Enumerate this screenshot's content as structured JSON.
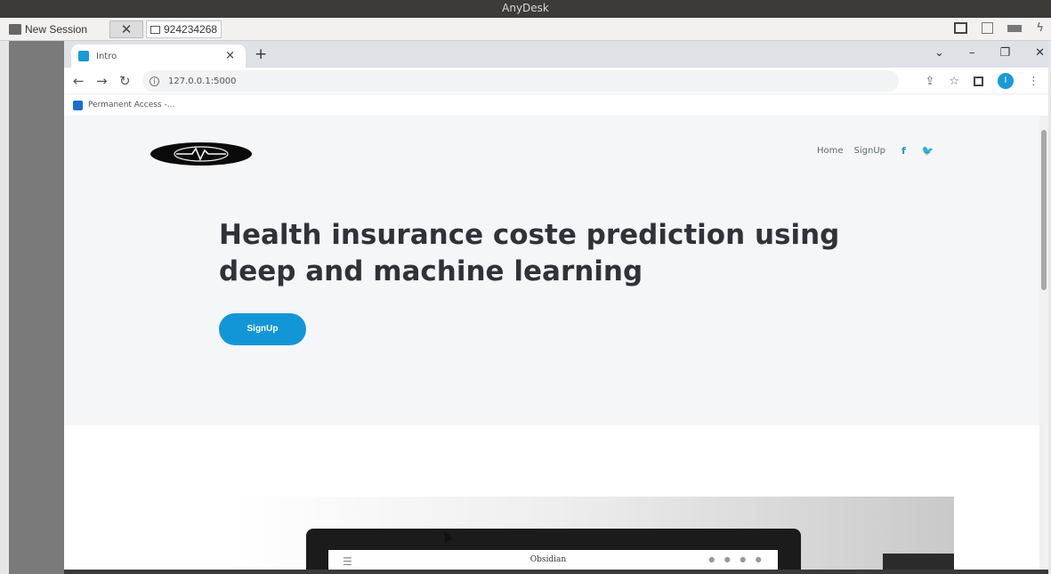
{
  "os": {
    "window_title": "AnyDesk"
  },
  "anydesk": {
    "new_session_label": "New Session",
    "close_glyph": "✕",
    "remote_id": "924234268",
    "icons": [
      "monitor-icon",
      "chat-icon",
      "keyboard-icon",
      "lightning-icon"
    ]
  },
  "browser": {
    "tab_title": "Intro",
    "tab_close": "×",
    "new_tab": "+",
    "window_controls": [
      "⌄",
      "–",
      "❐",
      "✕"
    ],
    "url": "127.0.0.1:5000",
    "bookmark": "Permanent Access -..."
  },
  "site": {
    "nav": {
      "home": "Home",
      "signup": "SignUp",
      "facebook": "f",
      "twitter": "🐦"
    },
    "hero_title": "Health insurance coste prediction using deep and machine learning",
    "signup_button": "SignUp",
    "preview_brand": "Obsidian",
    "accent_color": "#1396d8"
  }
}
